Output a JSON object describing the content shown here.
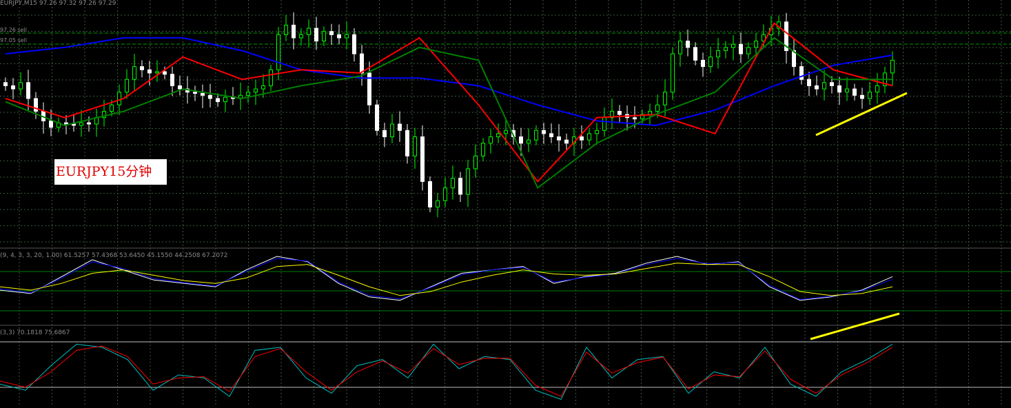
{
  "header": {
    "price": "EURJPY,M15 97.26 97.32 97.26 97.29",
    "price_levels": [
      "97.26 sell",
      "97.05 sell"
    ],
    "oscillator": "(9, 4, 3, 3, 20, 1.00) 61.5257 57.4368 53.6450 45.1550 44.2508 67.2072",
    "stochastic": "(3,3) 70.1818 75.6867"
  },
  "annotation": {
    "label": "EURJPY15分钟"
  },
  "colors": {
    "background": "#000000",
    "grid": "#3a5a3a",
    "candle_bull": "#00ff00",
    "candle_bear": "#ffffff",
    "ma_slow": "#0000ff",
    "ma_mid": "#ff0000",
    "ma_fast": "#008000",
    "trendline": "#ffff00",
    "stoch_main": "#00c0c0",
    "stoch_signal": "#ff0000"
  },
  "chart_data": [
    {
      "type": "candlestick",
      "symbol": "EURJPY",
      "timeframe": "M15",
      "ylim": [
        93.8,
        97.6
      ],
      "close": [
        96.3,
        96.25,
        96.35,
        96.1,
        95.9,
        95.75,
        95.65,
        95.72,
        95.7,
        95.68,
        95.72,
        95.7,
        95.8,
        95.9,
        96.0,
        96.2,
        96.4,
        96.6,
        96.55,
        96.5,
        96.52,
        96.48,
        96.3,
        96.25,
        96.2,
        96.18,
        96.15,
        96.1,
        96.05,
        96.12,
        96.1,
        96.15,
        96.2,
        96.25,
        96.3,
        96.55,
        97.1,
        97.25,
        97.05,
        97.1,
        97.2,
        97.0,
        97.15,
        97.1,
        97.05,
        97.1,
        96.8,
        96.5,
        96.0,
        95.6,
        95.5,
        95.7,
        95.6,
        95.2,
        95.5,
        94.8,
        94.4,
        94.5,
        94.7,
        94.85,
        94.6,
        95.0,
        95.2,
        95.4,
        95.5,
        95.55,
        95.6,
        95.5,
        95.4,
        95.45,
        95.6,
        95.55,
        95.5,
        95.45,
        95.4,
        95.5,
        95.45,
        95.55,
        95.6,
        95.8,
        95.9,
        95.85,
        95.8,
        95.78,
        95.85,
        95.9,
        96.0,
        96.2,
        96.8,
        97.0,
        96.9,
        96.7,
        96.6,
        96.75,
        96.85,
        96.9,
        96.95,
        96.8,
        96.9,
        97.0,
        97.1,
        97.2,
        97.3,
        96.85,
        96.6,
        96.4,
        96.3,
        96.25,
        96.35,
        96.3,
        96.2,
        96.25,
        96.15,
        96.1,
        96.2,
        96.3,
        96.5,
        96.7
      ]
    },
    {
      "type": "line",
      "series": [
        {
          "color": "#0000ff",
          "values": [
            96.8,
            96.9,
            97.05,
            97.05,
            96.85,
            96.55,
            96.42,
            96.42,
            96.3,
            96.0,
            95.75,
            95.68,
            95.92,
            96.3,
            96.62,
            96.78
          ]
        },
        {
          "color": "#ff0000",
          "values": [
            96.1,
            95.8,
            96.1,
            96.75,
            96.4,
            96.55,
            96.5,
            97.05,
            96.0,
            94.8,
            95.8,
            95.85,
            95.55,
            97.28,
            96.55,
            96.3
          ]
        },
        {
          "color": "#008000",
          "values": [
            96.05,
            95.68,
            95.9,
            96.25,
            96.1,
            96.3,
            96.45,
            96.9,
            96.7,
            94.7,
            95.4,
            95.85,
            96.2,
            97.05,
            96.4,
            96.4
          ]
        }
      ]
    },
    {
      "type": "line",
      "series": [
        {
          "color": "#ffffff",
          "values": [
            50,
            45,
            70,
            95,
            80,
            65,
            60,
            55,
            80,
            100,
            92,
            60,
            40,
            35,
            55,
            75,
            80,
            85,
            60,
            70,
            75,
            90,
            100,
            88,
            92,
            55,
            35,
            40,
            50,
            70
          ]
        },
        {
          "color": "#0000ff",
          "values": [
            52,
            46,
            68,
            92,
            82,
            67,
            61,
            56,
            78,
            97,
            93,
            62,
            42,
            37,
            54,
            73,
            80,
            84,
            62,
            69,
            74,
            88,
            97,
            89,
            91,
            57,
            36,
            41,
            49,
            66
          ]
        },
        {
          "color": "#ffff00",
          "values": [
            55,
            50,
            60,
            75,
            80,
            72,
            64,
            60,
            68,
            85,
            88,
            72,
            55,
            42,
            48,
            62,
            72,
            80,
            74,
            72,
            74,
            82,
            90,
            88,
            88,
            70,
            48,
            42,
            45,
            55
          ]
        }
      ]
    },
    {
      "type": "line",
      "series": [
        {
          "color": "#00c0c0",
          "values": [
            30,
            20,
            60,
            95,
            90,
            70,
            20,
            45,
            40,
            10,
            85,
            90,
            40,
            15,
            60,
            70,
            40,
            95,
            55,
            75,
            70,
            20,
            5,
            90,
            40,
            70,
            75,
            15,
            50,
            40,
            90,
            30,
            10,
            50,
            70,
            95
          ]
        },
        {
          "color": "#ff0000",
          "values": [
            35,
            25,
            50,
            85,
            92,
            75,
            30,
            40,
            42,
            18,
            75,
            88,
            50,
            20,
            50,
            68,
            48,
            88,
            62,
            72,
            72,
            28,
            10,
            82,
            48,
            65,
            74,
            22,
            45,
            42,
            84,
            38,
            15,
            45,
            65,
            90
          ]
        }
      ]
    }
  ]
}
